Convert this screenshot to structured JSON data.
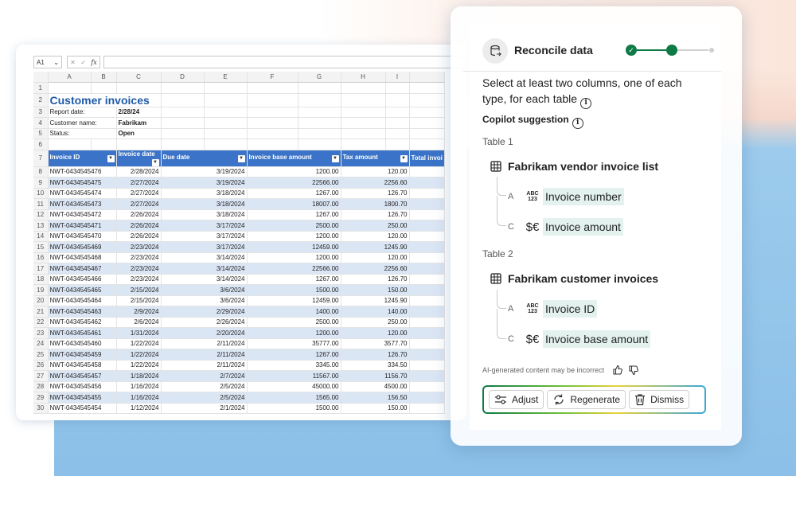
{
  "excel": {
    "namebox": "A1",
    "fx_label": "fx",
    "columns": [
      "A",
      "B",
      "C",
      "D",
      "E",
      "F",
      "G",
      "H",
      "I"
    ],
    "row_numbers": [
      "1",
      "2",
      "3",
      "4",
      "5",
      "6",
      "7",
      "8",
      "9",
      "10",
      "11",
      "12",
      "13",
      "14",
      "15",
      "16",
      "17",
      "18",
      "19",
      "20",
      "21",
      "22",
      "23",
      "24",
      "25",
      "26",
      "27",
      "28",
      "29",
      "30"
    ],
    "title": "Customer invoices",
    "report_date_label": "Report date:",
    "report_date_value": "2/28/24",
    "customer_name_label": "Customer name:",
    "customer_name_value": "Fabrikam",
    "status_label": "Status:",
    "status_value": "Open",
    "table_headers": [
      "Invoice ID",
      "Invoice date",
      "Due date",
      "Invoice base amount",
      "Tax amount",
      "Total invoi"
    ],
    "rows": [
      [
        "NWT-0434545476",
        "2/28/2024",
        "3/19/2024",
        "1200.00",
        "120.00"
      ],
      [
        "NWT-0434545475",
        "2/27/2024",
        "3/19/2024",
        "22566.00",
        "2256.60"
      ],
      [
        "NWT-0434545474",
        "2/27/2024",
        "3/18/2024",
        "1267.00",
        "126.70"
      ],
      [
        "NWT-0434545473",
        "2/27/2024",
        "3/18/2024",
        "18007.00",
        "1800.70"
      ],
      [
        "NWT-0434545472",
        "2/26/2024",
        "3/18/2024",
        "1267.00",
        "126.70"
      ],
      [
        "NWT-0434545471",
        "2/26/2024",
        "3/17/2024",
        "2500.00",
        "250.00"
      ],
      [
        "NWT-0434545470",
        "2/26/2024",
        "3/17/2024",
        "1200.00",
        "120.00"
      ],
      [
        "NWT-0434545469",
        "2/23/2024",
        "3/17/2024",
        "12459.00",
        "1245.90"
      ],
      [
        "NWT-0434545468",
        "2/23/2024",
        "3/14/2024",
        "1200.00",
        "120.00"
      ],
      [
        "NWT-0434545467",
        "2/23/2024",
        "3/14/2024",
        "22566.00",
        "2256.60"
      ],
      [
        "NWT-0434545466",
        "2/23/2024",
        "3/14/2024",
        "1267.00",
        "126.70"
      ],
      [
        "NWT-0434545465",
        "2/15/2024",
        "3/6/2024",
        "1500.00",
        "150.00"
      ],
      [
        "NWT-0434545464",
        "2/15/2024",
        "3/6/2024",
        "12459.00",
        "1245.90"
      ],
      [
        "NWT-0434545463",
        "2/9/2024",
        "2/29/2024",
        "1400.00",
        "140.00"
      ],
      [
        "NWT-0434545462",
        "2/6/2024",
        "2/26/2024",
        "2500.00",
        "250.00"
      ],
      [
        "NWT-0434545461",
        "1/31/2024",
        "2/20/2024",
        "1200.00",
        "120.00"
      ],
      [
        "NWT-0434545460",
        "1/22/2024",
        "2/11/2024",
        "35777.00",
        "3577.70"
      ],
      [
        "NWT-0434545459",
        "1/22/2024",
        "2/11/2024",
        "1267.00",
        "126.70"
      ],
      [
        "NWT-0434545458",
        "1/22/2024",
        "2/11/2024",
        "3345.00",
        "334.50"
      ],
      [
        "NWT-0434545457",
        "1/18/2024",
        "2/7/2024",
        "11567.00",
        "1156.70"
      ],
      [
        "NWT-0434545456",
        "1/16/2024",
        "2/5/2024",
        "45000.00",
        "4500.00"
      ],
      [
        "NWT-0434545455",
        "1/16/2024",
        "2/5/2024",
        "1565.00",
        "156.50"
      ],
      [
        "NWT-0434545454",
        "1/12/2024",
        "2/1/2024",
        "1500.00",
        "150.00"
      ]
    ]
  },
  "panel": {
    "title": "Reconcile data",
    "instruction": "Select at least two columns, one of each type, for each table",
    "suggestion_label": "Copilot suggestion",
    "table1_label": "Table 1",
    "table1_name": "Fabrikam vendor invoice list",
    "table1_cols": [
      {
        "letter": "A",
        "type": "ABC 123",
        "name": "Invoice number"
      },
      {
        "letter": "C",
        "type": "$€",
        "name": "Invoice amount"
      }
    ],
    "table2_label": "Table 2",
    "table2_name": "Fabrikam customer invoices",
    "table2_cols": [
      {
        "letter": "A",
        "type": "ABC 123",
        "name": "Invoice ID"
      },
      {
        "letter": "C",
        "type": "$€",
        "name": "Invoice base amount"
      }
    ],
    "disclaimer": "AI-generated content may be incorrect",
    "buttons": {
      "adjust": "Adjust",
      "regenerate": "Regenerate",
      "dismiss": "Dismiss"
    },
    "accent_color": "#0e7a46"
  }
}
